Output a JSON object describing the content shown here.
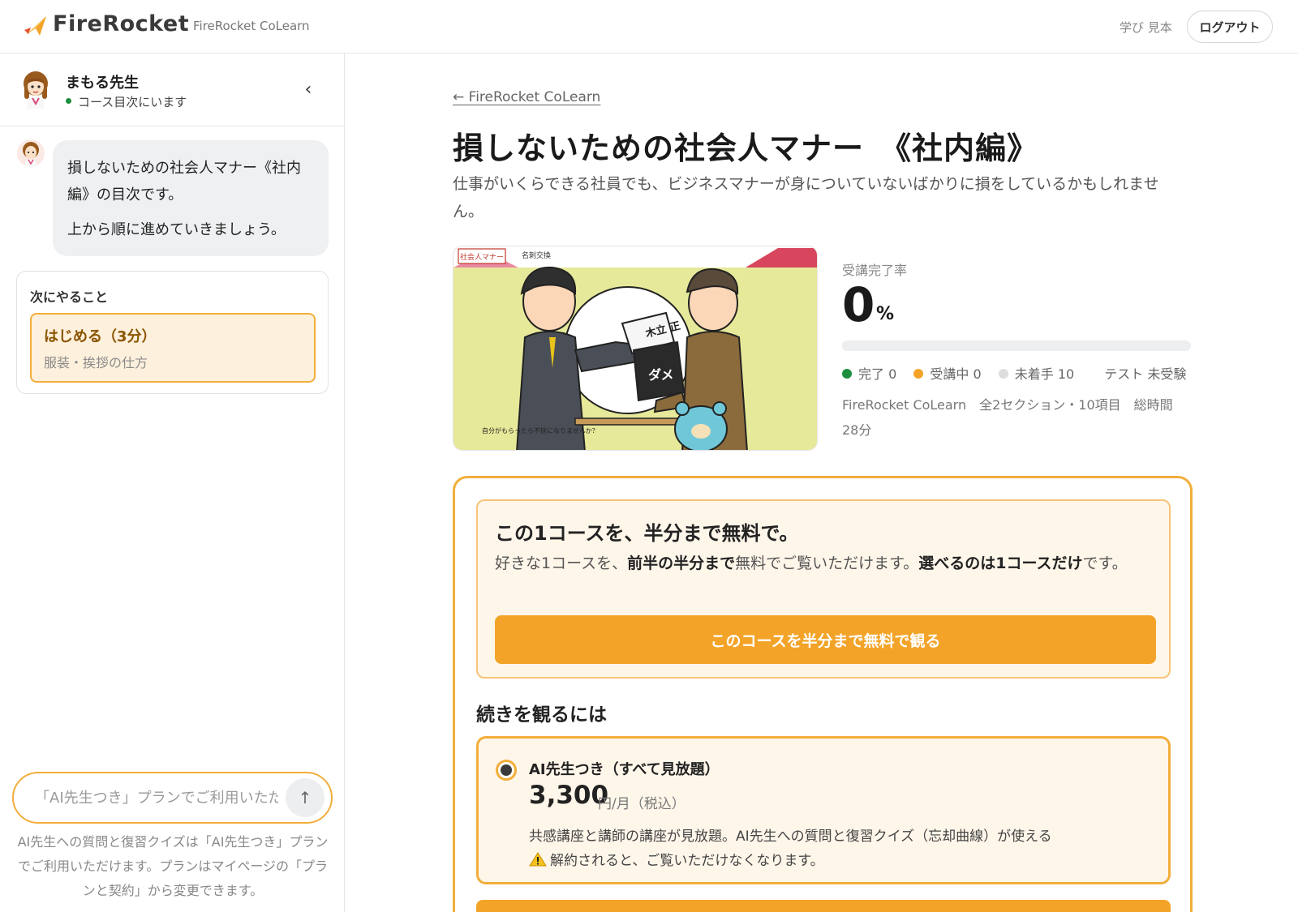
{
  "header": {
    "brand": "FireRocket",
    "sub": "FireRocket CoLearn",
    "link": "学び 見本",
    "logout": "ログアウト"
  },
  "sidebar": {
    "teacher_name": "まもる先生",
    "status": "コース目次にいます",
    "collapse_icon": "chevron-left",
    "message_line1": "損しないための社会人マナー《社内編》の目次です。",
    "message_line2": "上から順に進めていきましょう。",
    "next_title": "次にやること",
    "next_item_title": "はじめる（3分）",
    "next_item_sub": "服装・挨拶の仕方",
    "input_placeholder": "「AI先生つき」プランでご利用いただけます",
    "send_icon": "arrow-up",
    "note": "AI先生への質問と復習クイズは「AI先生つき」プランでご利用いただけます。プランはマイページの「プランと契約」から変更できます。"
  },
  "main": {
    "back_link": "← FireRocket CoLearn",
    "title": "損しないための社会人マナー　《社内編》",
    "description": "仕事がいくらできる社員でも、ビジネスマナーが身についていないばかりに損をしているかもしれません。",
    "thumbnail": {
      "badge": "社会人マナー",
      "scene_label": "名刺交換",
      "card_text": "木立 正",
      "card_mark": "ダメ",
      "caption": "自分がもらったら不快になりませんか？"
    },
    "progress": {
      "label": "受講完了率",
      "value": "0",
      "unit": "%",
      "fraction": 0,
      "completed": "完了 0",
      "in_progress": "受講中 0",
      "not_started": "未着手 10",
      "test": "テスト 未受験",
      "meta": "FireRocket CoLearn　全2セクション・10項目　総時間 28分",
      "colors": {
        "completed": "#1e8e3e",
        "in_progress": "#f3a428",
        "not_started": "#dddddd"
      }
    },
    "offer": {
      "free_title": "この1コースを、半分まで無料で。",
      "free_desc_1": "好きな1コースを、",
      "free_desc_2": "前半の半分まで",
      "free_desc_3": "無料でご覧いただけます。",
      "free_desc_4": "選べるのは1コースだけ",
      "free_desc_5": "です。",
      "free_button": "このコースを半分まで無料で観る",
      "continue_title": "続きを観るには",
      "plan_name": "AI先生つき（すべて見放題）",
      "plan_price": "3,300",
      "plan_unit": "円/月（税込）",
      "plan_desc": "共感講座と講師の講座が見放題。AI先生への質問と復習クイズ（忘却曲線）が使える",
      "plan_warning": "解約されると、ご覧いただけなくなります。"
    }
  },
  "colors": {
    "accent": "#f3a428",
    "accent_border": "#f2ae3a",
    "status_green": "#1e8e3e"
  }
}
